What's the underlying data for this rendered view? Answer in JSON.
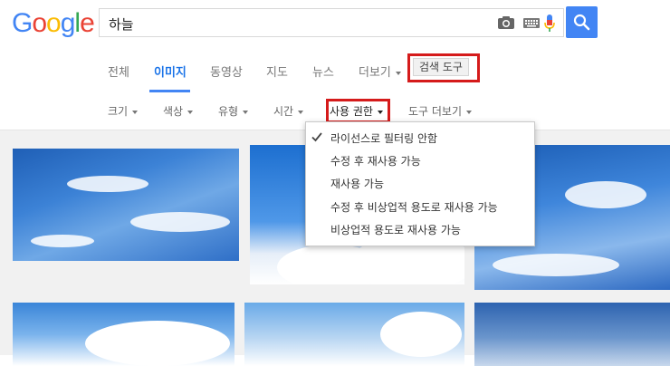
{
  "header": {
    "logo_letters": [
      "G",
      "o",
      "o",
      "g",
      "l",
      "e"
    ],
    "logo_colors": [
      "#4285f4",
      "#ea4335",
      "#fbbc05",
      "#4285f4",
      "#34a853",
      "#ea4335"
    ],
    "search_value": "하늘"
  },
  "tabs": [
    {
      "label": "전체"
    },
    {
      "label": "이미지",
      "active": true
    },
    {
      "label": "동영상"
    },
    {
      "label": "지도"
    },
    {
      "label": "뉴스"
    },
    {
      "label": "더보기"
    }
  ],
  "search_tools_label": "검색 도구",
  "filters": [
    {
      "label": "크기"
    },
    {
      "label": "색상"
    },
    {
      "label": "유형"
    },
    {
      "label": "시간"
    },
    {
      "label": "사용 권한"
    },
    {
      "label": "도구 더보기"
    }
  ],
  "usage_rights_menu": [
    {
      "label": "라이선스로 필터링 안함",
      "selected": true
    },
    {
      "label": "수정 후 재사용 가능"
    },
    {
      "label": "재사용 가능"
    },
    {
      "label": "수정 후 비상업적 용도로 재사용 가능"
    },
    {
      "label": "비상업적 용도로 재사용 가능"
    }
  ],
  "colors": {
    "accent": "#4285f4",
    "highlight_box": "#d51b1b",
    "active_tab": "#1a73e8"
  },
  "icons": [
    "camera-icon",
    "keyboard-icon",
    "microphone-icon",
    "search-icon",
    "check-icon",
    "caret-down-icon"
  ]
}
